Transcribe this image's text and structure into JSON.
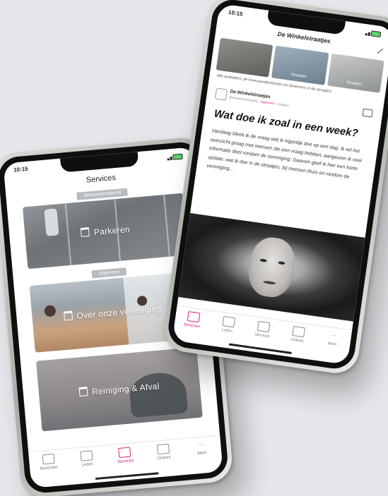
{
  "left_phone": {
    "status_time": "10:15",
    "title": "Services",
    "sections": [
      {
        "chip": "Bewonersverbond",
        "card_label": "Parkeren",
        "card_icon": "parking-icon"
      },
      {
        "chip": "Algemeen",
        "card_label": "Over onze vereniging",
        "card_icon": "building-icon"
      },
      {
        "card_label": "Reiniging & Afval",
        "card_icon": "trash-icon"
      }
    ],
    "tabs": [
      {
        "label": "Berichten",
        "icon": "mail-icon",
        "active": false
      },
      {
        "label": "Ledes",
        "icon": "people-icon",
        "active": false
      },
      {
        "label": "Services",
        "icon": "star-icon",
        "active": true
      },
      {
        "label": "Onthek",
        "icon": "folder-icon",
        "active": false
      },
      {
        "label": "Meer",
        "icon": "more-icon",
        "active": false
      }
    ]
  },
  "right_phone": {
    "status_time": "10:15",
    "header_title": "De Winkelstraatjes",
    "thumbnails": [
      "",
      "Straatjes",
      "Straatjes"
    ],
    "thumb_caption": "Alle winkeliers, de horecaondernemers en bewoners in de straatjes",
    "post": {
      "author": "De Winkelstraatjes",
      "meta_prefix": "Bewonersvereniging · ",
      "meta_link": "Algemeen",
      "meta_suffix": " · 3 dagen",
      "title": "Wat doe ik zoal in een week?",
      "body": "Vandaag bleek ik de vraag wat ik eigenlijk doe op een dag. Ik wil het overzicht graag met mensen die een vraag hebben, aangezien ik veel informatie deel rondom de vereniging. Daarom geef ik hier een korte update: wat ik doe in de straatjes, bij mensen thuis en rondom de vereniging..."
    },
    "tabs": [
      {
        "label": "Berichten",
        "icon": "mail-icon",
        "active": true
      },
      {
        "label": "Leden",
        "icon": "people-icon",
        "active": false
      },
      {
        "label": "Services",
        "icon": "star-icon",
        "active": false
      },
      {
        "label": "Onthek",
        "icon": "folder-icon",
        "active": false
      },
      {
        "label": "Meer",
        "icon": "more-icon",
        "active": false
      }
    ]
  },
  "colors": {
    "accent": "#e0197d",
    "background": "#e5e7ea"
  }
}
